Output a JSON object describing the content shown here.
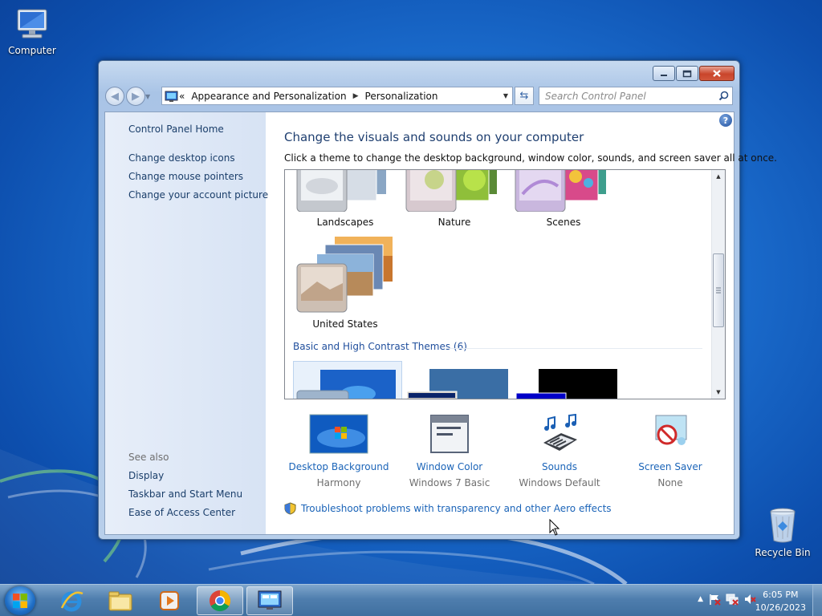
{
  "desktop": {
    "computer_label": "Computer",
    "recycle_label": "Recycle Bin"
  },
  "window": {
    "address": {
      "crumb_root_glyph": "«",
      "crumb1": "Appearance and Personalization",
      "crumb2": "Personalization"
    },
    "search_placeholder": "Search Control Panel",
    "sidebar": {
      "home": "Control Panel Home",
      "links": [
        "Change desktop icons",
        "Change mouse pointers",
        "Change your account picture"
      ],
      "see_also": "See also",
      "see_also_links": [
        "Display",
        "Taskbar and Start Menu",
        "Ease of Access Center"
      ]
    },
    "main": {
      "help_glyph": "?",
      "title": "Change the visuals and sounds on your computer",
      "subtitle": "Click a theme to change the desktop background, window color, sounds, and screen saver all at once.",
      "themes": [
        "Landscapes",
        "Nature",
        "Scenes",
        "United States"
      ],
      "basic_group": "Basic and High Contrast Themes (6)",
      "bottom": [
        {
          "label": "Desktop Background",
          "value": "Harmony"
        },
        {
          "label": "Window Color",
          "value": "Windows 7 Basic"
        },
        {
          "label": "Sounds",
          "value": "Windows Default"
        },
        {
          "label": "Screen Saver",
          "value": "None"
        }
      ],
      "troubleshoot": "Troubleshoot problems with transparency and other Aero effects"
    }
  },
  "taskbar": {
    "time": "6:05 PM",
    "date": "10/26/2023"
  },
  "colors": {
    "accent_link": "#1b64b8",
    "title": "#1f3f70"
  }
}
